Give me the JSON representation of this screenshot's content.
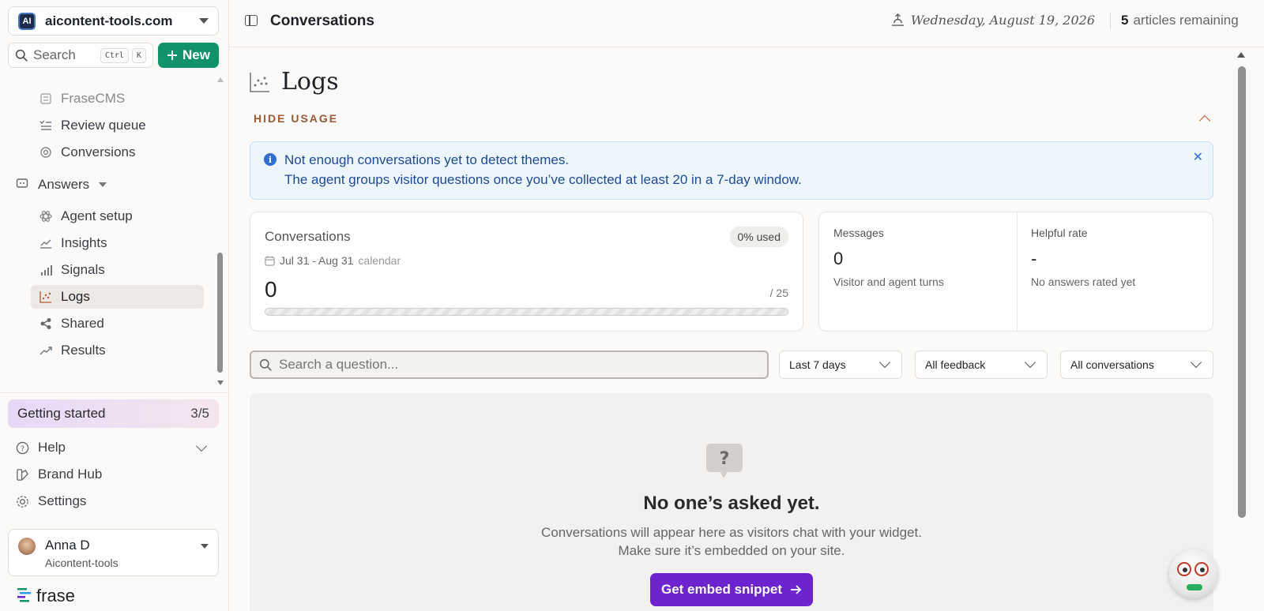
{
  "workspace": {
    "logo_text": "AI",
    "name": "aicontent-tools.com"
  },
  "search": {
    "label": "Search",
    "kbd1": "Ctrl",
    "kbd2": "K"
  },
  "new_button": {
    "label": "New"
  },
  "nav": {
    "items_top": [
      {
        "label": "FraseCMS",
        "icon": "document-icon",
        "muted": true
      },
      {
        "label": "Review queue",
        "icon": "checklist-icon"
      },
      {
        "label": "Conversions",
        "icon": "target-icon"
      }
    ],
    "answers_section": {
      "label": "Answers",
      "icon": "chat-box-icon"
    },
    "answers_items": [
      {
        "label": "Agent setup",
        "icon": "atom-icon"
      },
      {
        "label": "Insights",
        "icon": "line-chart-icon"
      },
      {
        "label": "Signals",
        "icon": "signal-bars-icon"
      },
      {
        "label": "Logs",
        "icon": "scatter-icon",
        "active": true
      },
      {
        "label": "Shared",
        "icon": "share-icon"
      },
      {
        "label": "Results",
        "icon": "trend-icon"
      }
    ]
  },
  "getting_started": {
    "label": "Getting started",
    "progress": "3/5"
  },
  "bottom_nav": {
    "help": "Help",
    "brand_hub": "Brand Hub",
    "settings": "Settings"
  },
  "user": {
    "name": "Anna D",
    "org": "Aicontent-tools"
  },
  "brand": {
    "name": "frase"
  },
  "header": {
    "breadcrumb": "Conversations",
    "date": "Wednesday, August 19, 2026",
    "remaining_count": "5",
    "remaining_label": "articles remaining"
  },
  "page": {
    "title": "Logs",
    "hide_usage": "HIDE USAGE"
  },
  "banner": {
    "line1": "Not enough conversations yet to detect themes.",
    "line2": "The agent groups visitor questions once you’ve collected at least 20 in a 7-day window."
  },
  "usage": {
    "title": "Conversations",
    "used_pill": "0% used",
    "range": "Jul 31 - Aug 31",
    "range_type": "calendar",
    "count": "0",
    "max": "/ 25",
    "progress_fraction": 0
  },
  "stats": {
    "messages": {
      "label": "Messages",
      "value": "0",
      "sub": "Visitor and agent turns"
    },
    "helpful": {
      "label": "Helpful rate",
      "value": "-",
      "sub": "No answers rated yet"
    }
  },
  "filters": {
    "search_placeholder": "Search a question...",
    "range": "Last 7 days",
    "feedback": "All feedback",
    "conversations": "All conversations"
  },
  "empty": {
    "title": "No one’s asked yet.",
    "line1": "Conversations will appear here as visitors chat with your widget.",
    "line2": "Make sure it’s embedded on your site.",
    "button": "Get embed snippet"
  },
  "colors": {
    "brand_green": "#12926b",
    "accent_purple": "#6d24cf",
    "info_blue": "#2f6ed6",
    "hide_usage_brown": "#9b5a35"
  }
}
